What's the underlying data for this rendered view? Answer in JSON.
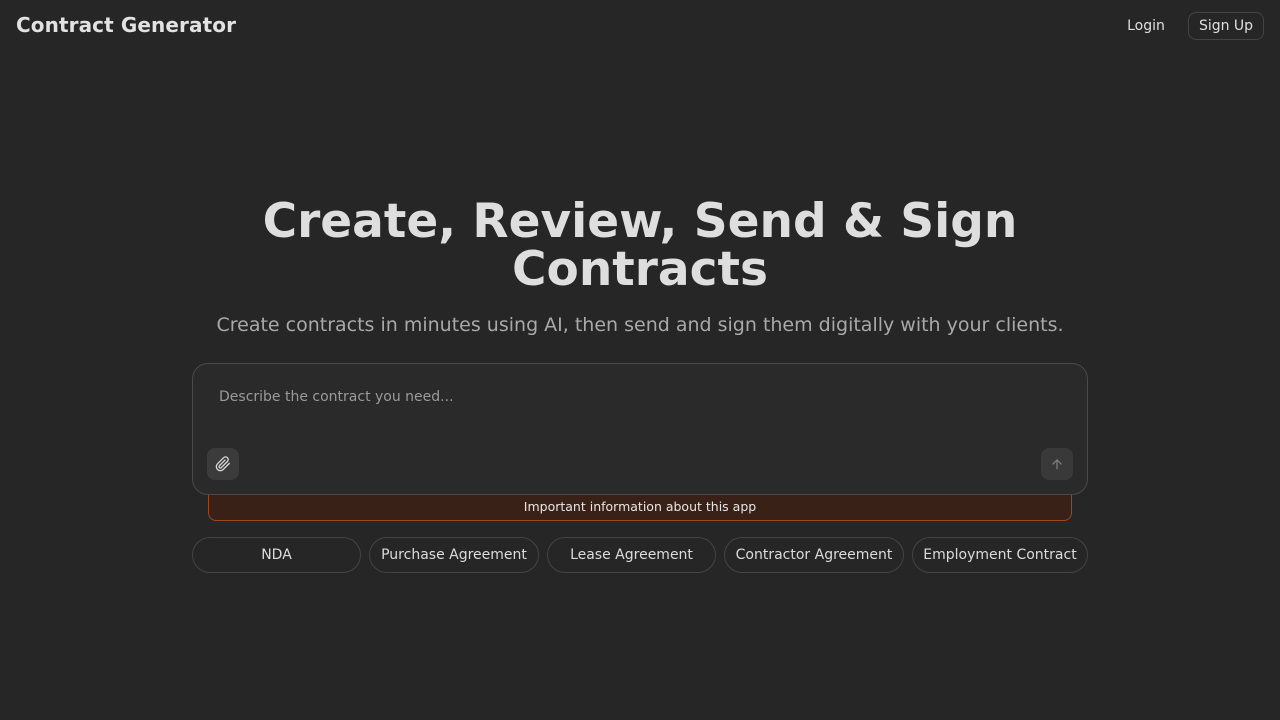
{
  "header": {
    "brand": "Contract Generator",
    "login_label": "Login",
    "signup_label": "Sign Up"
  },
  "hero": {
    "title": "Create, Review, Send & Sign Contracts",
    "subtitle": "Create contracts in minutes using AI, then send and sign them digitally with your clients."
  },
  "composer": {
    "placeholder": "Describe the contract you need...",
    "value": "",
    "attach_icon": "paperclip-icon",
    "send_icon": "arrow-up-icon"
  },
  "notice": {
    "text": "Important information about this app"
  },
  "templates": [
    {
      "label": "NDA"
    },
    {
      "label": "Purchase Agreement"
    },
    {
      "label": "Lease Agreement"
    },
    {
      "label": "Contractor Agreement"
    },
    {
      "label": "Employment Contract"
    }
  ],
  "colors": {
    "background": "#262626",
    "notice_background": "#3a2118",
    "notice_border": "#a0461f"
  }
}
